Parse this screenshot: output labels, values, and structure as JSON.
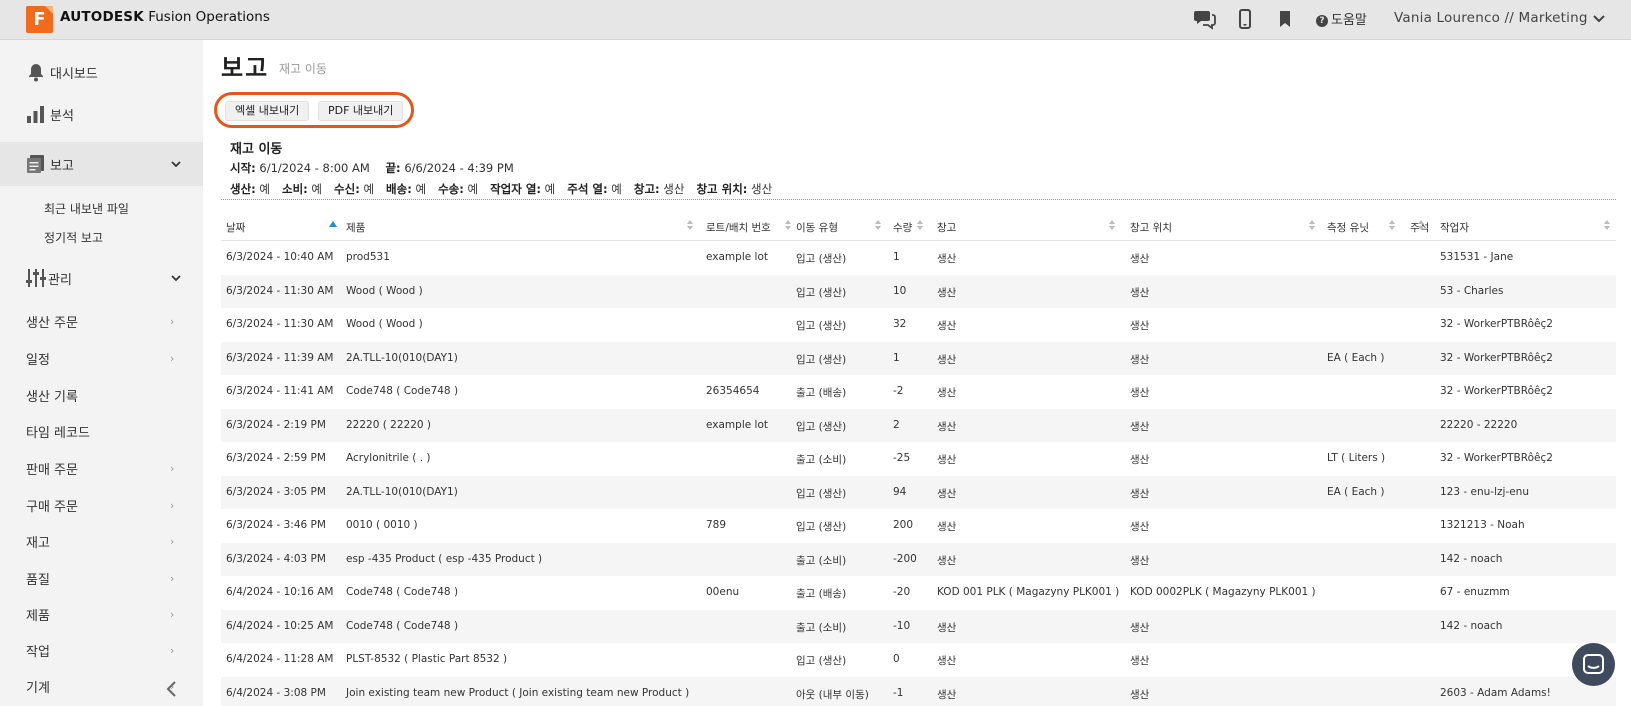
{
  "app": {
    "logo_letter": "F",
    "brand_bold": "AUTODESK",
    "brand_rest": "Fusion Operations",
    "help_label": "도움말",
    "user_label": "Vania Lourenco // Marketing"
  },
  "sidebar": {
    "dashboard": "대시보드",
    "analysis": "분석",
    "reports": "보고",
    "reports_sub": [
      "최근 내보낸 파일",
      "정기적 보고"
    ],
    "admin": "관리",
    "links": [
      "생산 주문",
      "일정",
      "생산 기록",
      "타임 레코드",
      "판매 주문",
      "구매 주문",
      "재고",
      "품질",
      "제품",
      "작업",
      "기계"
    ]
  },
  "page": {
    "title": "보고",
    "subtitle": "재고 이동",
    "export_excel": "엑셀 내보내기",
    "export_pdf": "PDF 내보내기"
  },
  "report": {
    "title": "재고 이동",
    "start_label": "시작:",
    "start_value": "6/1/2024 - 8:00 AM",
    "end_label": "끝:",
    "end_value": "6/6/2024 - 4:39 PM",
    "filters": [
      {
        "label": "생산:",
        "value": "예"
      },
      {
        "label": "소비:",
        "value": "예"
      },
      {
        "label": "수신:",
        "value": "예"
      },
      {
        "label": "배송:",
        "value": "예"
      },
      {
        "label": "수송:",
        "value": "예"
      },
      {
        "label": "작업자 열:",
        "value": "예"
      },
      {
        "label": "주석 열:",
        "value": "예"
      },
      {
        "label": "창고:",
        "value": "생산"
      },
      {
        "label": "창고 위치:",
        "value": "생산"
      }
    ]
  },
  "table": {
    "columns": [
      "날짜",
      "제품",
      "로트/배치 번호",
      "이동 유형",
      "수량",
      "창고",
      "창고 위치",
      "측정 유닛",
      "주석",
      "작업자"
    ],
    "rows": [
      [
        "6/3/2024 - 10:40 AM",
        "prod531",
        "example lot",
        "입고 (생산)",
        "1",
        "생산",
        "생산",
        "",
        "",
        "531531 - Jane"
      ],
      [
        "6/3/2024 - 11:30 AM",
        "Wood ( Wood )",
        "",
        "입고 (생산)",
        "10",
        "생산",
        "생산",
        "",
        "",
        "53 - Charles"
      ],
      [
        "6/3/2024 - 11:30 AM",
        "Wood ( Wood )",
        "",
        "입고 (생산)",
        "32",
        "생산",
        "생산",
        "",
        "",
        "32 - WorkerPTBRôêç2"
      ],
      [
        "6/3/2024 - 11:39 AM",
        "2A.TLL-10(010(DAY1)",
        "",
        "입고 (생산)",
        "1",
        "생산",
        "생산",
        "EA ( Each )",
        "",
        "32 - WorkerPTBRôêç2"
      ],
      [
        "6/3/2024 - 11:41 AM",
        "Code748 ( Code748 )",
        "26354654",
        "출고 (배송)",
        "-2",
        "생산",
        "생산",
        "",
        "",
        "32 - WorkerPTBRôêç2"
      ],
      [
        "6/3/2024 - 2:19 PM",
        "22220 ( 22220 )",
        "example lot",
        "입고 (생산)",
        "2",
        "생산",
        "생산",
        "",
        "",
        "22220 - 22220"
      ],
      [
        "6/3/2024 - 2:59 PM",
        "Acrylonitrile ( . )",
        "",
        "출고 (소비)",
        "-25",
        "생산",
        "생산",
        "LT ( Liters )",
        "",
        "32 - WorkerPTBRôêç2"
      ],
      [
        "6/3/2024 - 3:05 PM",
        "2A.TLL-10(010(DAY1)",
        "",
        "입고 (생산)",
        "94",
        "생산",
        "생산",
        "EA ( Each )",
        "",
        "123 - enu-lzj-enu"
      ],
      [
        "6/3/2024 - 3:46 PM",
        "0010 ( 0010 )",
        "789",
        "입고 (생산)",
        "200",
        "생산",
        "생산",
        "",
        "",
        "1321213 - Noah"
      ],
      [
        "6/3/2024 - 4:03 PM",
        "esp -435 Product ( esp -435 Product )",
        "",
        "출고 (소비)",
        "-200",
        "생산",
        "생산",
        "",
        "",
        "142 - noach"
      ],
      [
        "6/4/2024 - 10:16 AM",
        "Code748 ( Code748 )",
        "00enu",
        "출고 (배송)",
        "-20",
        "KOD 001 PLK ( Magazyny PLK001 )",
        "KOD 0002PLK ( Magazyny PLK001 )",
        "",
        "",
        "67 - enuzmm"
      ],
      [
        "6/4/2024 - 10:25 AM",
        "Code748 ( Code748 )",
        "",
        "출고 (소비)",
        "-10",
        "생산",
        "생산",
        "",
        "",
        "142 - noach"
      ],
      [
        "6/4/2024 - 11:28 AM",
        "PLST-8532 ( Plastic Part 8532 )",
        "",
        "입고 (생산)",
        "0",
        "생산",
        "생산",
        "",
        "",
        ""
      ],
      [
        "6/4/2024 - 3:08 PM",
        "Join existing team new Product ( Join existing team new Product )",
        "",
        "아웃 (내부 이동)",
        "-1",
        "생산",
        "생산",
        "",
        "",
        "2603 - Adam Adams!"
      ]
    ]
  }
}
